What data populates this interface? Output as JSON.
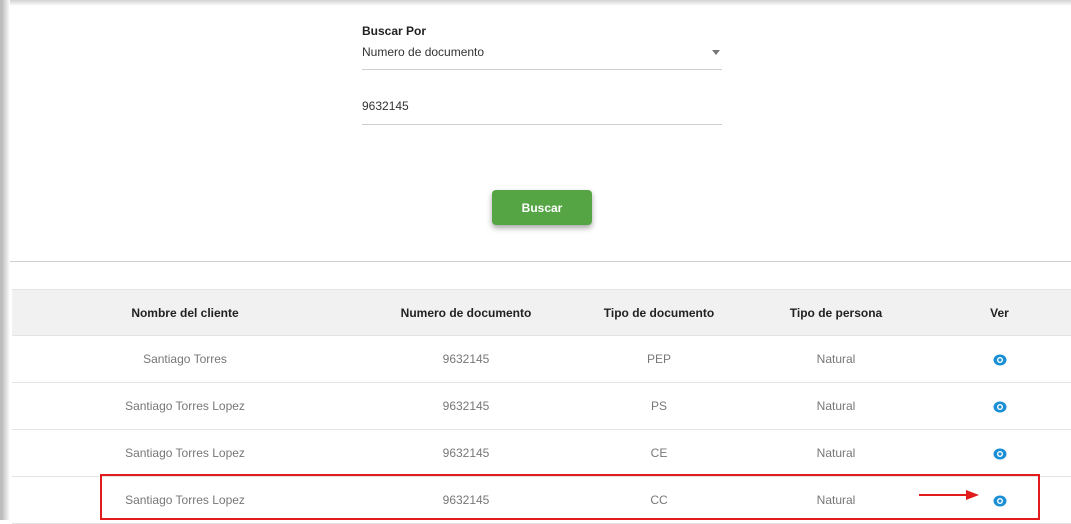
{
  "search": {
    "label": "Buscar Por",
    "selected_option": "Numero de documento",
    "document_value": "9632145",
    "button_label": "Buscar"
  },
  "table": {
    "headers": [
      "Nombre del cliente",
      "Numero de documento",
      "Tipo de documento",
      "Tipo de persona",
      "Ver"
    ],
    "rows": [
      {
        "name": "Santiago Torres",
        "document": "9632145",
        "doc_type": "PEP",
        "person_type": "Natural",
        "view_icon": "eye-icon"
      },
      {
        "name": "Santiago Torres Lopez",
        "document": "9632145",
        "doc_type": "PS",
        "person_type": "Natural",
        "view_icon": "eye-icon"
      },
      {
        "name": "Santiago Torres Lopez",
        "document": "9632145",
        "doc_type": "CE",
        "person_type": "Natural",
        "view_icon": "eye-icon"
      },
      {
        "name": "Santiago Torres Lopez",
        "document": "9632145",
        "doc_type": "CC",
        "person_type": "Natural",
        "view_icon": "eye-icon"
      }
    ]
  },
  "colors": {
    "button": "#55a545",
    "eye_icon": "#1a8fd6",
    "highlight": "#e21c1c"
  }
}
